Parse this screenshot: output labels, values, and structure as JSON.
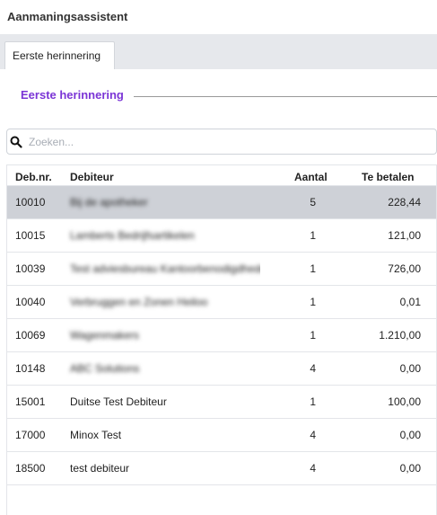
{
  "window": {
    "title": "Aanmaningsassistent"
  },
  "tabs": [
    {
      "label": "Eerste herinnering",
      "active": true
    }
  ],
  "section": {
    "title": "Eerste herinnering"
  },
  "search": {
    "placeholder": "Zoeken...",
    "value": "",
    "icon": "search-icon"
  },
  "colors": {
    "accent": "#7b35d6",
    "selected_row": "#ced1d7",
    "tab_strip": "#e6e8ec"
  },
  "table": {
    "columns": [
      "Deb.nr.",
      "Debiteur",
      "Aantal",
      "Te betalen"
    ],
    "rows": [
      {
        "nr": "10010",
        "debiteur": "Bij de apotheker",
        "aantal": "5",
        "bedrag": "228,44",
        "selected": true,
        "redacted": true
      },
      {
        "nr": "10015",
        "debiteur": "Lamberts Bedrijfsartikelen",
        "aantal": "1",
        "bedrag": "121,00",
        "selected": false,
        "redacted": true
      },
      {
        "nr": "10039",
        "debiteur": "Test adviesbureau Kantoorbenodigdheden",
        "aantal": "1",
        "bedrag": "726,00",
        "selected": false,
        "redacted": true
      },
      {
        "nr": "10040",
        "debiteur": "Verbruggen en Zonen Heiloo",
        "aantal": "1",
        "bedrag": "0,01",
        "selected": false,
        "redacted": true
      },
      {
        "nr": "10069",
        "debiteur": "Wagenmakers",
        "aantal": "1",
        "bedrag": "1.210,00",
        "selected": false,
        "redacted": true
      },
      {
        "nr": "10148",
        "debiteur": "ABC Solutions",
        "aantal": "4",
        "bedrag": "0,00",
        "selected": false,
        "redacted": true
      },
      {
        "nr": "15001",
        "debiteur": "Duitse Test Debiteur",
        "aantal": "1",
        "bedrag": "100,00",
        "selected": false,
        "redacted": false
      },
      {
        "nr": "17000",
        "debiteur": "Minox Test",
        "aantal": "4",
        "bedrag": "0,00",
        "selected": false,
        "redacted": false
      },
      {
        "nr": "18500",
        "debiteur": "test debiteur",
        "aantal": "4",
        "bedrag": "0,00",
        "selected": false,
        "redacted": false
      }
    ]
  }
}
